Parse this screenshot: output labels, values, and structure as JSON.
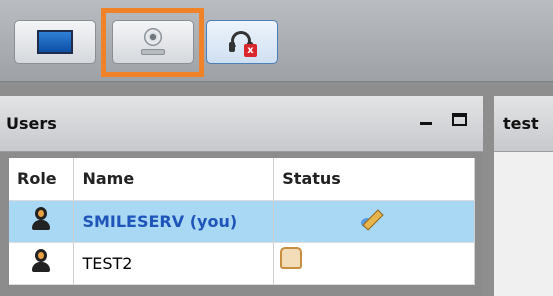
{
  "toolbar": {
    "buttons": [
      {
        "icon": "monitor-icon"
      },
      {
        "icon": "webcam-icon",
        "highlighted": true
      },
      {
        "icon": "headset-muted-icon",
        "badge": "x"
      }
    ],
    "highlight_color": "#f08228"
  },
  "users_panel": {
    "title": "Users",
    "minimize_symbol": "_",
    "columns": [
      "Role",
      "Name",
      "Status"
    ],
    "rows": [
      {
        "role_icon": "user-icon",
        "name": "SMILESERV (you)",
        "status_icon": "pencil-icon",
        "selected": true
      },
      {
        "role_icon": "user-icon",
        "name": "TEST2",
        "status_icon": "hand-icon",
        "selected": false
      }
    ]
  },
  "right_panel": {
    "title": "test"
  },
  "colors": {
    "selected_row": "#a9d8f5",
    "selected_name": "#1f55b8"
  }
}
